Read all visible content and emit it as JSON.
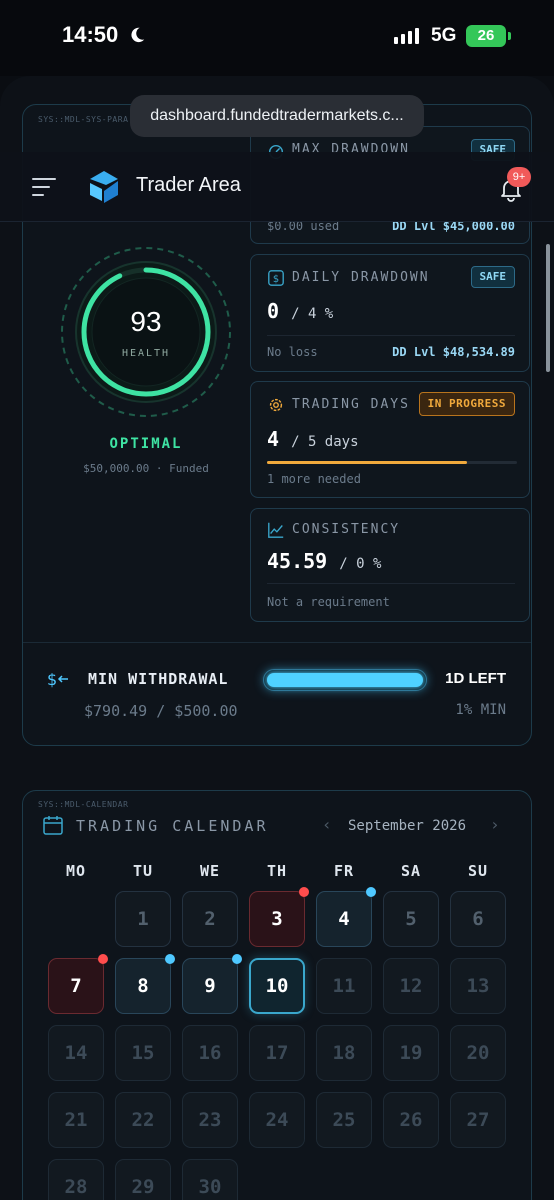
{
  "status_bar": {
    "time": "14:50",
    "network": "5G",
    "battery": "26"
  },
  "browser": {
    "url": "dashboard.fundedtradermarkets.c..."
  },
  "header": {
    "brand": "Trader Area",
    "notifications_badge": "9+"
  },
  "account_panel": {
    "sys_label": "SYS::MDL-SYS-PARA",
    "health": {
      "value": "93",
      "label": "HEALTH",
      "status": "OPTIMAL",
      "account": "$50,000.00 · Funded",
      "fraction": 0.93
    },
    "max_drawdown": {
      "title": "MAX DRAWDOWN",
      "badge": "SAFE",
      "used": "$0.00 used",
      "level": "DD Lvl $45,000.00"
    },
    "daily_drawdown": {
      "title": "DAILY DRAWDOWN",
      "badge": "SAFE",
      "value": "0",
      "limit": "/ 4 %",
      "note": "No loss",
      "level": "DD Lvl $48,534.89"
    },
    "trading_days": {
      "title": "TRADING DAYS",
      "badge": "IN PROGRESS",
      "value": "4",
      "limit": "/ 5 days",
      "note": "1 more needed",
      "progress": 0.8
    },
    "consistency": {
      "title": "CONSISTENCY",
      "value": "45.59",
      "limit": "/ 0 %",
      "note": "Not a requirement"
    },
    "min_withdrawal": {
      "title": "MIN WITHDRAWAL",
      "amounts": "$790.49 / $500.00",
      "time_left": "1D LEFT",
      "min_note": "1% MIN",
      "progress": 1.0
    }
  },
  "calendar": {
    "sys_label": "SYS::MDL-CALENDAR",
    "title": "TRADING CALENDAR",
    "month": "September 2026",
    "weekdays": [
      "MO",
      "TU",
      "WE",
      "TH",
      "FR",
      "SA",
      "SU"
    ],
    "days": [
      "1",
      "2",
      "3",
      "4",
      "5",
      "6",
      "7",
      "8",
      "9",
      "10",
      "11",
      "12",
      "13",
      "14",
      "15",
      "16",
      "17",
      "18",
      "19",
      "20",
      "21",
      "22",
      "23",
      "24",
      "25",
      "26",
      "27",
      "28",
      "29",
      "30"
    ]
  },
  "colors": {
    "accent": "#4fd2ff",
    "safe": "#8fd8f4",
    "warning": "#f0a93c",
    "loss": "#ff4d4d",
    "health": "#3ee3a3"
  }
}
